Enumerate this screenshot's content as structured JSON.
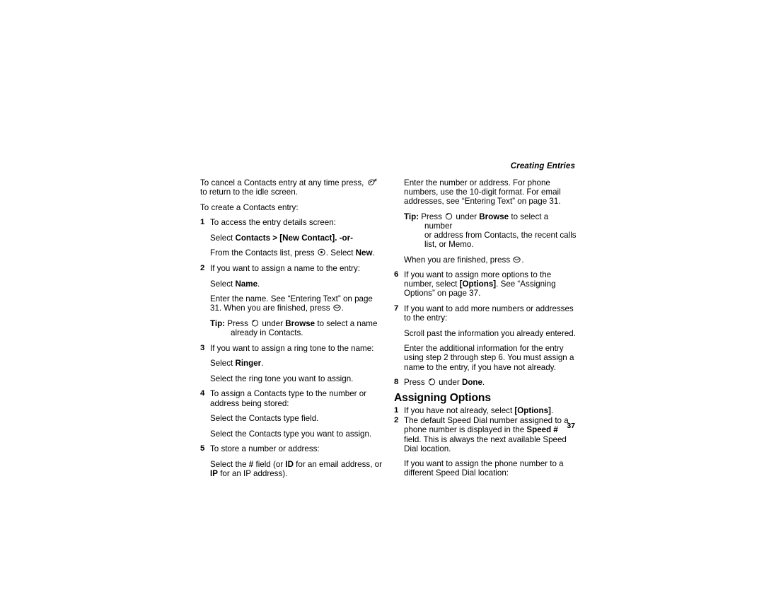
{
  "page": {
    "running_head": "Creating Entries",
    "folio": "37"
  },
  "icons": {
    "end_call": "end-call-key-icon",
    "center_select": "center-select-key-icon",
    "menu_ok": "ok-menu-key-icon",
    "left_softkey": "left-soft-key-icon"
  },
  "left_column": {
    "intro_1a": "To cancel a Contacts entry at any time press, ",
    "intro_1b": " to return to the idle screen.",
    "intro_2": "To create a Contacts entry:",
    "step1": {
      "num": "1",
      "text": "To access the entry details screen:",
      "line_a_pre": "Select ",
      "line_a_bold1": "Contacts > [New Contact]. -or-",
      "line_b_pre": "From the Contacts list, press ",
      "line_b_mid": ". Select ",
      "line_b_bold": "New",
      "line_b_post": "."
    },
    "step2": {
      "num": "2",
      "text": "If you want to assign a name to the entry:",
      "line_a_pre": "Select ",
      "line_a_bold": "Name",
      "line_a_post": ".",
      "line_b": "Enter the name. See “Entering Text” on page 31. When you are finished, press ",
      "line_b_post": ".",
      "tip_label": "Tip:",
      "tip_pre": " Press ",
      "tip_mid": " under ",
      "tip_bold": "Browse",
      "tip_post": " to select a name",
      "tip_cont": "already in Contacts."
    },
    "step3": {
      "num": "3",
      "text": "If you want to assign a ring tone to the name:",
      "line_a_pre": "Select ",
      "line_a_bold": "Ringer",
      "line_a_post": ".",
      "line_b": "Select the ring tone you want to assign."
    },
    "step4": {
      "num": "4",
      "text": "To assign a Contacts type to the number or address being stored:",
      "line_a": "Select the Contacts type field.",
      "line_b": "Select the Contacts type you want to assign."
    },
    "step5": {
      "num": "5",
      "text": "To store a number or address:",
      "line_a_pre": "Select the ",
      "line_a_b1": "#",
      "line_a_mid1": " field (or ",
      "line_a_b2": "ID",
      "line_a_mid2": " for an email address, or ",
      "line_a_b3": "IP",
      "line_a_post": " for an IP address)."
    }
  },
  "right_column": {
    "para_1": "Enter the number or address. For phone numbers, use the 10-digit format. For email addresses, see “Entering Text” on page 31.",
    "tip": {
      "label": "Tip:",
      "pre": " Press ",
      "mid": " under ",
      "bold": "Browse",
      "post": " to select a number",
      "cont_1": "or address from Contacts, the recent calls",
      "cont_2": "list, or Memo."
    },
    "para_2_pre": "When you are finished, press ",
    "para_2_post": ".",
    "step6": {
      "num": "6",
      "pre": "If you want to assign more options to the number, select ",
      "bold": "[Options]",
      "post": ". See “Assigning Options” on page 37."
    },
    "step7": {
      "num": "7",
      "text": "If you want to add more numbers or addresses to the entry:",
      "line_a": "Scroll past the information you already entered.",
      "line_b": "Enter the additional information for the entry using step 2 through step 6. You must assign a name to the entry, if you have not already."
    },
    "step8": {
      "num": "8",
      "pre": "Press ",
      "mid": " under ",
      "bold": "Done",
      "post": "."
    },
    "section_heading": "Assigning Options",
    "opt_step1": {
      "num": "1",
      "pre": "If you have not already, select ",
      "bold": "[Options]",
      "post": "."
    },
    "opt_step2": {
      "num": "2",
      "pre": "The default Speed Dial number assigned to a phone number is displayed in the ",
      "bold": "Speed #",
      "post": " field. This is always the next available Speed Dial location."
    },
    "opt_para": "If you want to assign the phone number to a different Speed Dial location:"
  }
}
